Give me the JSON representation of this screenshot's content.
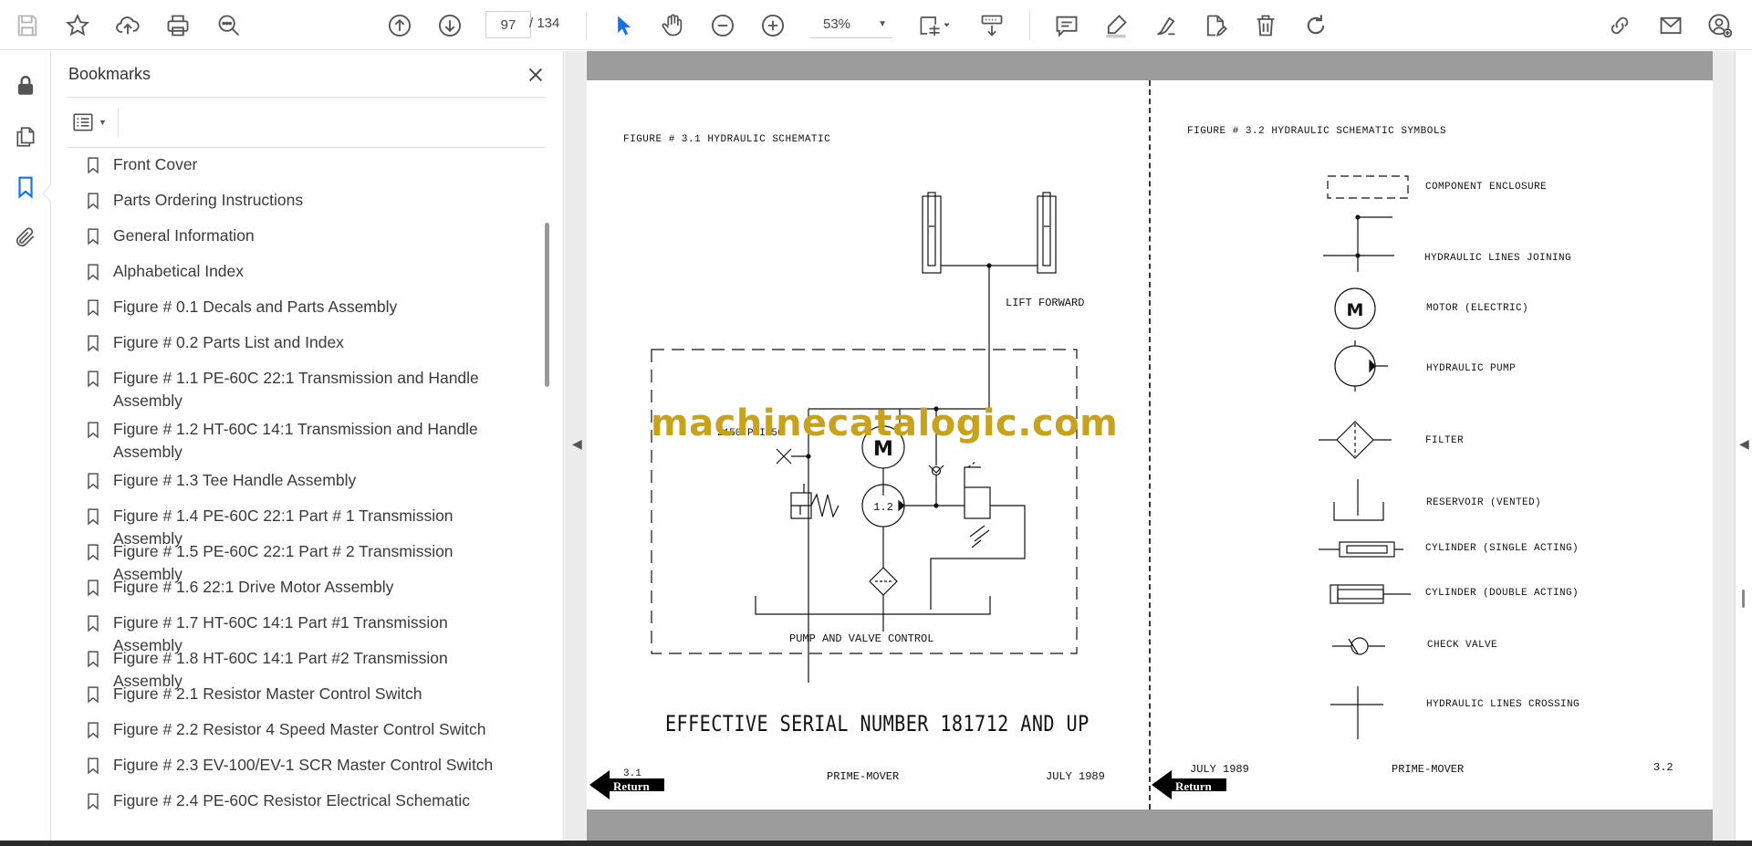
{
  "toolbar": {
    "page_current": "97",
    "page_total": "/ 134",
    "zoom": "53%"
  },
  "bookmarks": {
    "title": "Bookmarks",
    "items": [
      "Front Cover",
      "Parts Ordering Instructions",
      "General Information",
      "Alphabetical Index",
      "Figure # 0.1 Decals and Parts Assembly",
      "Figure # 0.2 Parts List and Index",
      "Figure # 1.1 PE-60C 22:1 Transmission and Handle Assembly",
      "Figure # 1.2 HT-60C 14:1 Transmission and Handle Assembly",
      "Figure # 1.3 Tee Handle Assembly",
      "Figure # 1.4 PE-60C 22:1 Part # 1 Transmission Assembly",
      "Figure # 1.5 PE-60C 22:1 Part # 2 Transmission Assembly",
      "Figure # 1.6 22:1 Drive Motor Assembly",
      "Figure # 1.7 HT-60C 14:1 Part #1 Transmission Assembly",
      "Figure # 1.8 HT-60C 14:1 Part #2 Transmission Assembly",
      "Figure # 2.1 Resistor Master Control Switch",
      "Figure # 2.2 Resistor 4 Speed Master Control Switch",
      "Figure # 2.3 EV-100/EV-1 SCR Master Control Switch",
      "Figure # 2.4 PE-60C Resistor Electrical Schematic"
    ]
  },
  "left_page": {
    "figure_title": "FIGURE # 3.1 HYDRAULIC SCHEMATIC",
    "lift_label": "LIFT FORWARD",
    "psi_label": "2150 PSI+50",
    "motor_label": "M",
    "pump_label": "1.2",
    "control_label": "PUMP AND VALVE CONTROL",
    "serial": "EFFECTIVE SERIAL NUMBER 181712 AND UP",
    "page_no": "3.1",
    "footer_center": "PRIME-MOVER",
    "footer_date": "JULY 1989",
    "return": "Return"
  },
  "right_page": {
    "figure_title": "FIGURE # 3.2 HYDRAULIC SCHEMATIC SYMBOLS",
    "symbols": [
      "COMPONENT ENCLOSURE",
      "HYDRAULIC LINES JOINING",
      "MOTOR (ELECTRIC)",
      "HYDRAULIC PUMP",
      "FILTER",
      "RESERVOIR (VENTED)",
      "CYLINDER (SINGLE ACTING)",
      "CYLINDER (DOUBLE ACTING)",
      "CHECK VALVE",
      "HYDRAULIC LINES CROSSING"
    ],
    "motor_symbol": "M",
    "footer_date": "JULY 1989",
    "footer_center": "PRIME-MOVER",
    "page_no": "3.2",
    "return": "Return"
  },
  "watermark": "machinecatalogic.com"
}
